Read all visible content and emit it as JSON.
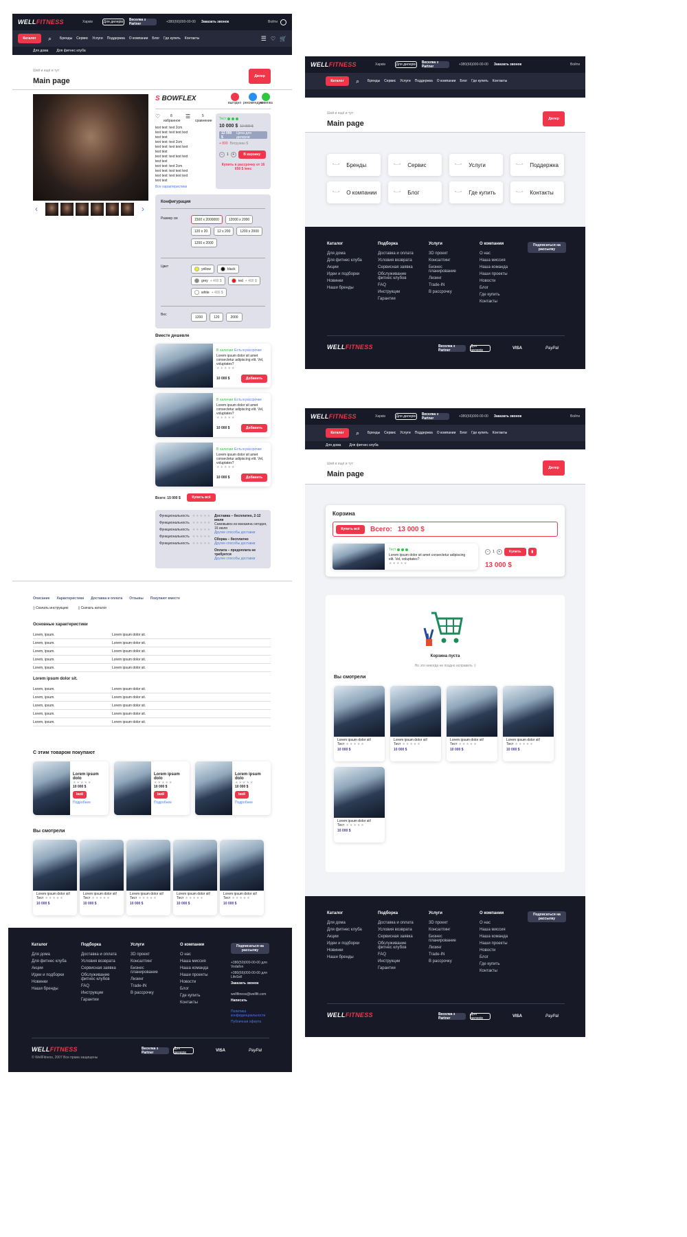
{
  "header": {
    "logo_a": "WELL",
    "logo_b": "FITNESS",
    "logo_sub": "DISTRIBUTING RETAIL CLUBS",
    "city": "Харків",
    "dealers": "Для дилерів",
    "partner": "Веселка з Partner",
    "phone": "+380(66)000-00-00",
    "callback": "Заказать звонок",
    "login": "Войти"
  },
  "nav": {
    "catalog": "Каталог",
    "items": [
      "Бренды",
      "Сервис",
      "Услуги",
      "Поддержка",
      "О компании",
      "Блог",
      "Где купить",
      "Контакты"
    ]
  },
  "subnav": [
    "Для дома",
    "Для фитнес клуба"
  ],
  "breadcrumb": "Шей и ещё и тут",
  "page_title": "Main page",
  "filter_btn": "Дилер",
  "product": {
    "brand": "BOWFLEX",
    "badges": [
      "выгодно",
      "рекомендую",
      "новинка"
    ],
    "fav_count": "8",
    "fav_label": "избранное",
    "cmp_count": "5",
    "cmp_label": "сравнение",
    "spec_lines": [
      "text text: text 2cm",
      "text text: text text text",
      "text text",
      "text text: text 2cm",
      "text text: text text text",
      "text text",
      "text text: text text text",
      "text text",
      "text text: text 2cm",
      "text text: text text text",
      "text text: text text text",
      "text text"
    ],
    "all_specs": "Все характеристики",
    "stock": "Тест",
    "price": "10 000 $",
    "old_price": "12 000 $",
    "dealer_price": "12 000 $",
    "dealer_label": "Цена для дилеров",
    "bonus": "+ 800",
    "bonus_label": "Вигрузиш $",
    "qty": "1",
    "to_cart": "В корзину",
    "installment": "Купить в рассрочку от 16 658 $ /мес"
  },
  "config": {
    "title": "Конфигурация",
    "size_label": "Размер см",
    "sizes": [
      "1500 x 2000000",
      "12000 x 2000",
      "120 x 20",
      "12 x 200",
      "1200 x 2000",
      "1200 x 2000"
    ],
    "color_label": "Цвет",
    "colors": [
      {
        "n": "yellow",
        "c": "#f4ee1e",
        "p": ""
      },
      {
        "n": "black",
        "c": "#111111",
        "p": ""
      },
      {
        "n": "grey",
        "c": "#888888",
        "p": "+ 400 $"
      },
      {
        "n": "red",
        "c": "#e8141e",
        "p": "+ 400 $"
      },
      {
        "n": "white",
        "c": "#ffffff",
        "p": "+ 400 $"
      }
    ],
    "weight_label": "Вес",
    "weights": [
      "1200",
      "120",
      "2000"
    ]
  },
  "together": {
    "title": "Вместе дешевле",
    "stock": "В наличии",
    "rating_label": "Есть в рассрочке",
    "desc": "Lorem ipsum dolor sit amet consectetur adipiscing elit. Vel, voluptates?",
    "price": "10 000 $",
    "add": "Добавить",
    "total_label": "Всего: 15 000 $",
    "buy_all": "Купить всё"
  },
  "funcs": [
    "Функциональность",
    "Функциональность",
    "Функциональность",
    "Функциональность",
    "Функциональность"
  ],
  "delivery": [
    {
      "t": "Доставка – бесплатно, 2-12 июля",
      "s": "Самовывоз из магазина сегодня, 16 июля",
      "l": "Другие способы доставки"
    },
    {
      "t": "Сборка – бесплатно",
      "s": "",
      "l": "Другие способы доставки"
    },
    {
      "t": "Оплата – предоплата не требуется",
      "s": "",
      "l": "Другие способы доставки"
    }
  ],
  "tabs": [
    "Описание",
    "Характеристики",
    "Доставка и оплата",
    "Отзывы",
    "Покупают вместе"
  ],
  "downloads": [
    "Скачать инструкцию",
    "Скачать каталог"
  ],
  "specs_main": {
    "title": "Основные характеристики",
    "rows": [
      [
        "Lorem, ipsum.",
        "Lorem ipsum dolor sit."
      ],
      [
        "Lorem, ipsum.",
        "Lorem ipsum dolor sit."
      ],
      [
        "Lorem, ipsum.",
        "Lorem ipsum dolor sit."
      ],
      [
        "Lorem, ipsum.",
        "Lorem ipsum dolor sit."
      ],
      [
        "Lorem, ipsum.",
        "Lorem ipsum dolor sit."
      ]
    ]
  },
  "specs_second": {
    "title": "Lorem ipsum dolor sit.",
    "rows": [
      [
        "Lorem, ipsum.",
        "Lorem ipsum dolor sit."
      ],
      [
        "Lorem, ipsum.",
        "Lorem ipsum dolor sit."
      ],
      [
        "Lorem, ipsum.",
        "Lorem ipsum dolor sit."
      ],
      [
        "Lorem, ipsum.",
        "Lorem ipsum dolor sit."
      ],
      [
        "Lorem, ipsum.",
        "Lorem ipsum dolor sit."
      ]
    ]
  },
  "also_bought": {
    "title": "С этим товаром покупают",
    "name": "Lorem ipsum dolo",
    "price": "10 000 $",
    "btn": "Івей",
    "more": "Подробнее"
  },
  "viewed": {
    "title": "Вы смотрели",
    "name": "Lorem ipsum dolor sit!",
    "stock": "Тест",
    "price": "10 000 $"
  },
  "footer": {
    "cols": [
      {
        "h": "Каталог",
        "items": [
          "Для дома",
          "Для фитнес клуба",
          "Акции",
          "Идеи и подборки",
          "Новинки",
          "Наши бренды"
        ]
      },
      {
        "h": "Подборка",
        "items": [
          "Доставка и оплата",
          "Условия возврата",
          "Сервисная заявка",
          "Обслуживание фитнес клубов",
          "FAQ",
          "Инструкции",
          "Гарантии"
        ]
      },
      {
        "h": "Услуги",
        "items": [
          "3D проект",
          "Консалтинг",
          "Бизнес планирование",
          "Лизинг",
          "Trade-IN",
          "В рассрочку"
        ]
      },
      {
        "h": "О компании",
        "items": [
          "О нас",
          "Наша миссия",
          "Наша команда",
          "Наши проекты",
          "Новости",
          "Блог",
          "Где купить",
          "Контакты"
        ]
      }
    ],
    "subscribe": "Подписаться на рассылку",
    "phone1": "+380(50)000-00-00 для Vodafon",
    "phone2": "+380(66)000-00-00 для LifeSell",
    "call": "Заказать звонок",
    "email": "wellfitness@wellfit.com",
    "write": "Написать",
    "policy": "Политика конфиденциальности",
    "offer": "Публичная оферта",
    "copyright": "© WellFitness, 2007 Все права защищены",
    "pay": [
      "VISA",
      "PayPal"
    ]
  },
  "catalog_tiles": [
    "Бренды",
    "Сервис",
    "Услуги",
    "Поддержка",
    "О компании",
    "Блог",
    "Где купить",
    "Контакты"
  ],
  "cart": {
    "title": "Корзина",
    "buy_all": "Купить всё",
    "total_label": "Всего:",
    "total": "13 000 $",
    "item_desc": "Lorem ipsum dolor sit amet consectetur adipiscing elit. Vel, voluptates?",
    "item_stock": "Тест",
    "qty": "1",
    "buy": "Купить",
    "sum": "13 000 $",
    "empty": "Корзина пуста",
    "empty_sub": "Но это никогда не поздно исправить :)"
  },
  "colors": {
    "accent": "#f0364a",
    "dark": "#171927",
    "nav": "#262a3b",
    "panel": "#dfe0ea"
  }
}
